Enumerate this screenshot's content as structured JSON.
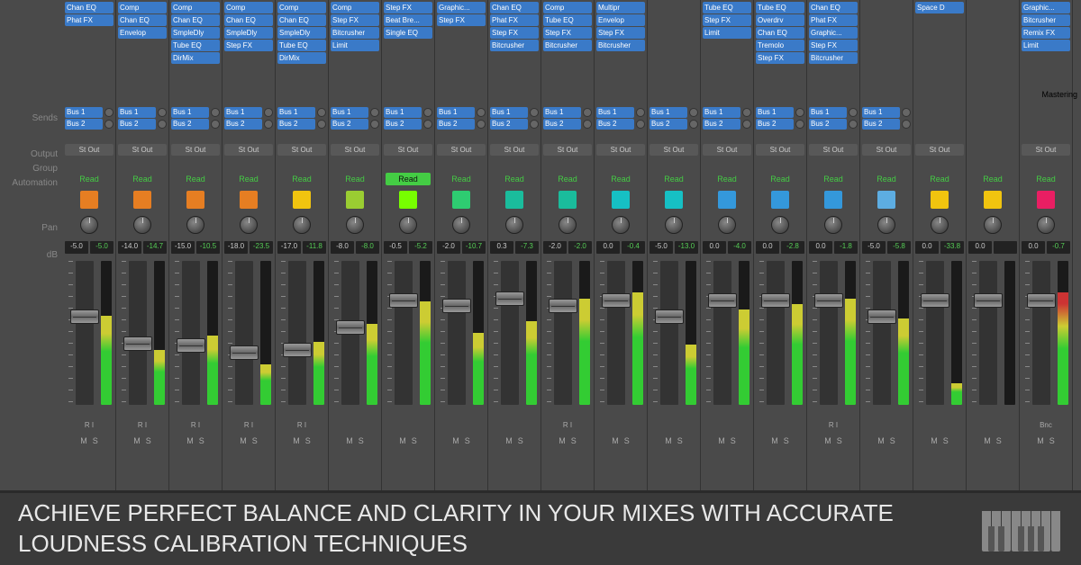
{
  "labels": {
    "sends": "Sends",
    "output": "Output",
    "group": "Group",
    "automation": "Automation",
    "pan": "Pan",
    "db": "dB",
    "mastering": "Mastering"
  },
  "bus1": "Bus 1",
  "bus2": "Bus 2",
  "stout": "St Out",
  "read": "Read",
  "ri": "R I",
  "m": "M",
  "s": "S",
  "bnc": "Bnc",
  "banner": "ACHIEVE PERFECT BALANCE AND CLARITY IN YOUR MIXES WITH ACCURATE LOUDNESS CALIBRATION TECHNIQUES",
  "channels": [
    {
      "inserts": [
        "Chan EQ",
        "Phat FX"
      ],
      "db": "-5.0",
      "peak": "-5.0",
      "fader": 58,
      "meter": 62,
      "ri": true,
      "icon": "#e67e22",
      "readActive": false
    },
    {
      "inserts": [
        "Comp",
        "Chan EQ",
        "Envelop"
      ],
      "db": "-14.0",
      "peak": "-14.7",
      "fader": 88,
      "meter": 38,
      "ri": true,
      "icon": "#e67e22",
      "readActive": false
    },
    {
      "inserts": [
        "Comp",
        "Chan EQ",
        "SmpleDly",
        "Tube EQ",
        "DirMix"
      ],
      "db": "-15.0",
      "peak": "-10.5",
      "fader": 90,
      "meter": 48,
      "ri": true,
      "icon": "#e67e22",
      "readActive": false
    },
    {
      "inserts": [
        "Comp",
        "Chan EQ",
        "SmpleDly",
        "Step FX"
      ],
      "db": "-18.0",
      "peak": "-23.5",
      "fader": 98,
      "meter": 28,
      "ri": true,
      "icon": "#e67e22",
      "readActive": false
    },
    {
      "inserts": [
        "Comp",
        "Chan EQ",
        "SmpleDly",
        "Tube EQ",
        "DirMix"
      ],
      "db": "-17.0",
      "peak": "-11.8",
      "fader": 95,
      "meter": 44,
      "ri": true,
      "icon": "#f1c40f",
      "readActive": false
    },
    {
      "inserts": [
        "Comp",
        "Step FX",
        "Bitcrusher",
        "Limit"
      ],
      "db": "-8.0",
      "peak": "-8.0",
      "fader": 70,
      "meter": 56,
      "ri": false,
      "icon": "#9acd32",
      "readActive": false
    },
    {
      "inserts": [
        "Step FX",
        "Beat Bre...",
        "Single EQ"
      ],
      "db": "-0.5",
      "peak": "-5.2",
      "fader": 40,
      "meter": 72,
      "ri": false,
      "icon": "#7f0",
      "readActive": true
    },
    {
      "inserts": [
        "Graphic...",
        "Step FX"
      ],
      "db": "-2.0",
      "peak": "-10.7",
      "fader": 46,
      "meter": 50,
      "ri": false,
      "icon": "#2ecc71",
      "readActive": false
    },
    {
      "inserts": [
        "Chan EQ",
        "Phat FX",
        "Step FX",
        "Bitcrusher"
      ],
      "db": "0.3",
      "peak": "-7.3",
      "fader": 38,
      "meter": 58,
      "ri": false,
      "icon": "#1abc9c",
      "readActive": false
    },
    {
      "inserts": [
        "Comp",
        "Tube EQ",
        "Step FX",
        "Bitcrusher"
      ],
      "db": "-2.0",
      "peak": "-2.0",
      "fader": 46,
      "meter": 74,
      "ri": true,
      "icon": "#1abc9c",
      "readActive": false
    },
    {
      "inserts": [
        "Multipr",
        "Envelop",
        "Step FX",
        "Bitcrusher"
      ],
      "db": "0.0",
      "peak": "-0.4",
      "fader": 40,
      "meter": 78,
      "ri": false,
      "icon": "#16c0c4",
      "readActive": false
    },
    {
      "inserts": [],
      "db": "-5.0",
      "peak": "-13.0",
      "fader": 58,
      "meter": 42,
      "ri": false,
      "icon": "#16c0c4",
      "readActive": false
    },
    {
      "inserts": [
        "Tube EQ",
        "Step FX",
        "Limit"
      ],
      "db": "0.0",
      "peak": "-4.0",
      "fader": 40,
      "meter": 66,
      "ri": false,
      "icon": "#3498db",
      "readActive": false
    },
    {
      "inserts": [
        "Tube EQ",
        "Overdrv",
        "Chan EQ",
        "Tremolo",
        "Step FX"
      ],
      "db": "0.0",
      "peak": "-2.8",
      "fader": 40,
      "meter": 70,
      "ri": false,
      "icon": "#3498db",
      "readActive": false
    },
    {
      "inserts": [
        "Chan EQ",
        "Phat FX",
        "Graphic...",
        "Step FX",
        "Bitcrusher"
      ],
      "db": "0.0",
      "peak": "-1.8",
      "fader": 40,
      "meter": 74,
      "ri": true,
      "icon": "#3498db",
      "readActive": false
    },
    {
      "inserts": [],
      "db": "-5.0",
      "peak": "-5.8",
      "fader": 58,
      "meter": 60,
      "ri": false,
      "icon": "#5dade2",
      "readActive": false
    },
    {
      "inserts": [
        "Space D"
      ],
      "db": "0.0",
      "peak": "-33.8",
      "fader": 40,
      "meter": 15,
      "ri": false,
      "icon": "#f1c40f",
      "readActive": false,
      "nosends": true,
      "noout": false
    },
    {
      "inserts": [],
      "db": "0.0",
      "peak": "",
      "fader": 40,
      "meter": 0,
      "ri": false,
      "icon": "#f1c40f",
      "readActive": false,
      "nosends": true,
      "noout": false,
      "empty": true
    },
    {
      "inserts": [
        "Graphic...",
        "Bitcrusher",
        "Remix FX",
        "Limit"
      ],
      "db": "0.0",
      "peak": "-0.7",
      "fader": 40,
      "meter": 78,
      "ri": false,
      "icon": "#e91e63",
      "readActive": false,
      "nosends": true,
      "noout": false,
      "bnc": true,
      "master": true
    }
  ]
}
